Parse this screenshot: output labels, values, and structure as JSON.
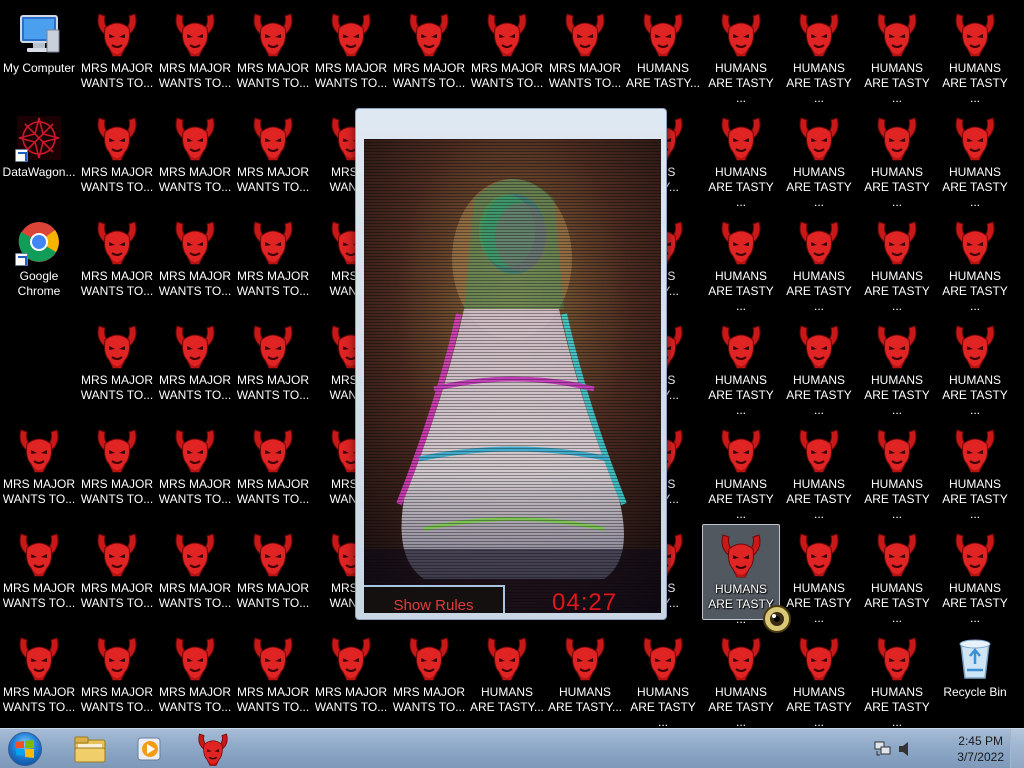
{
  "desktop": {
    "system_icons": [
      {
        "label": "My Computer",
        "kind": "computer"
      },
      {
        "label": "DataWagon...",
        "kind": "datawagon"
      },
      {
        "label": "Google\nChrome",
        "kind": "chrome"
      },
      {
        "label": "Recycle Bin",
        "kind": "recycle"
      }
    ],
    "game_icon_labels": {
      "mrs": "MRS MAJOR\nWANTS TO...",
      "humans": "HUMANS\nARE TASTY ...",
      "humans_alt": "HUMANS\nARE TASTY...",
      "humans_selected": "HUMANS\nARE TASTY ...",
      "mrs_partial": "MRS M\nWANTS",
      "humans_partial": "ANS\nSTY...",
      "edge_partial": "A\nA"
    },
    "icon_symbol": "red-horned-demon"
  },
  "popup": {
    "show_rules_label": "Show Rules",
    "timer": "04:27",
    "timer_color": "#e0161a"
  },
  "taskbar": {
    "start_label": "Start",
    "pinned": [
      {
        "name": "windows-explorer",
        "label": "Windows Explorer"
      },
      {
        "name": "media-player",
        "label": "Windows Media Player"
      },
      {
        "name": "mrs-major-app",
        "label": "MRS MAJOR"
      }
    ],
    "clock_time": "2:45 PM",
    "clock_date": "3/7/2022"
  }
}
